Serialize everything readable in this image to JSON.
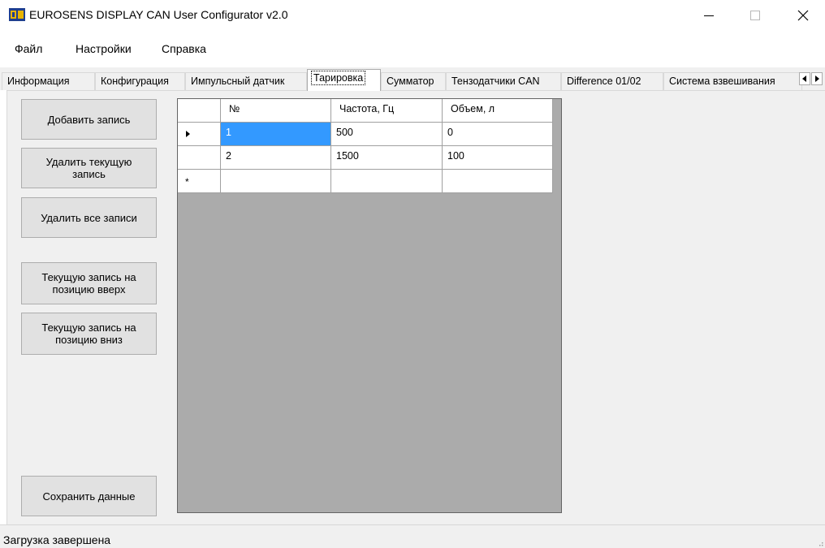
{
  "window": {
    "title": "EUROSENS DISPLAY CAN User Configurator v2.0",
    "icon": "app-logo-icon"
  },
  "menu": [
    {
      "label": "Файл"
    },
    {
      "label": "Настройки"
    },
    {
      "label": "Справка"
    }
  ],
  "tabs": [
    {
      "label": "Информация"
    },
    {
      "label": "Конфигурация"
    },
    {
      "label": "Импульсный датчик"
    },
    {
      "label": "Тарировка",
      "active": true
    },
    {
      "label": "Сумматор"
    },
    {
      "label": "Тензодатчики CAN"
    },
    {
      "label": "Difference 01/02"
    },
    {
      "label": "Система взвешивания"
    }
  ],
  "buttons": {
    "add_record": "Добавить запись",
    "delete_current": "Удалить текущую запись",
    "delete_all": "Удалить все записи",
    "move_up": "Текущую запись на позицию вверх",
    "move_down": "Текущую запись на позицию вниз",
    "save_data": "Сохранить данные"
  },
  "grid": {
    "columns": [
      "№",
      "Частота, Гц",
      "Объем, л"
    ],
    "rows": [
      {
        "n": "1",
        "freq": "500",
        "volume": "0"
      },
      {
        "n": "2",
        "freq": "1500",
        "volume": "100"
      }
    ],
    "new_row_marker": "*"
  },
  "status": {
    "text": "Загрузка завершена"
  },
  "colors": {
    "selection": "#3399ff",
    "grid_background": "#ababab",
    "panel": "#f0f0f0"
  }
}
